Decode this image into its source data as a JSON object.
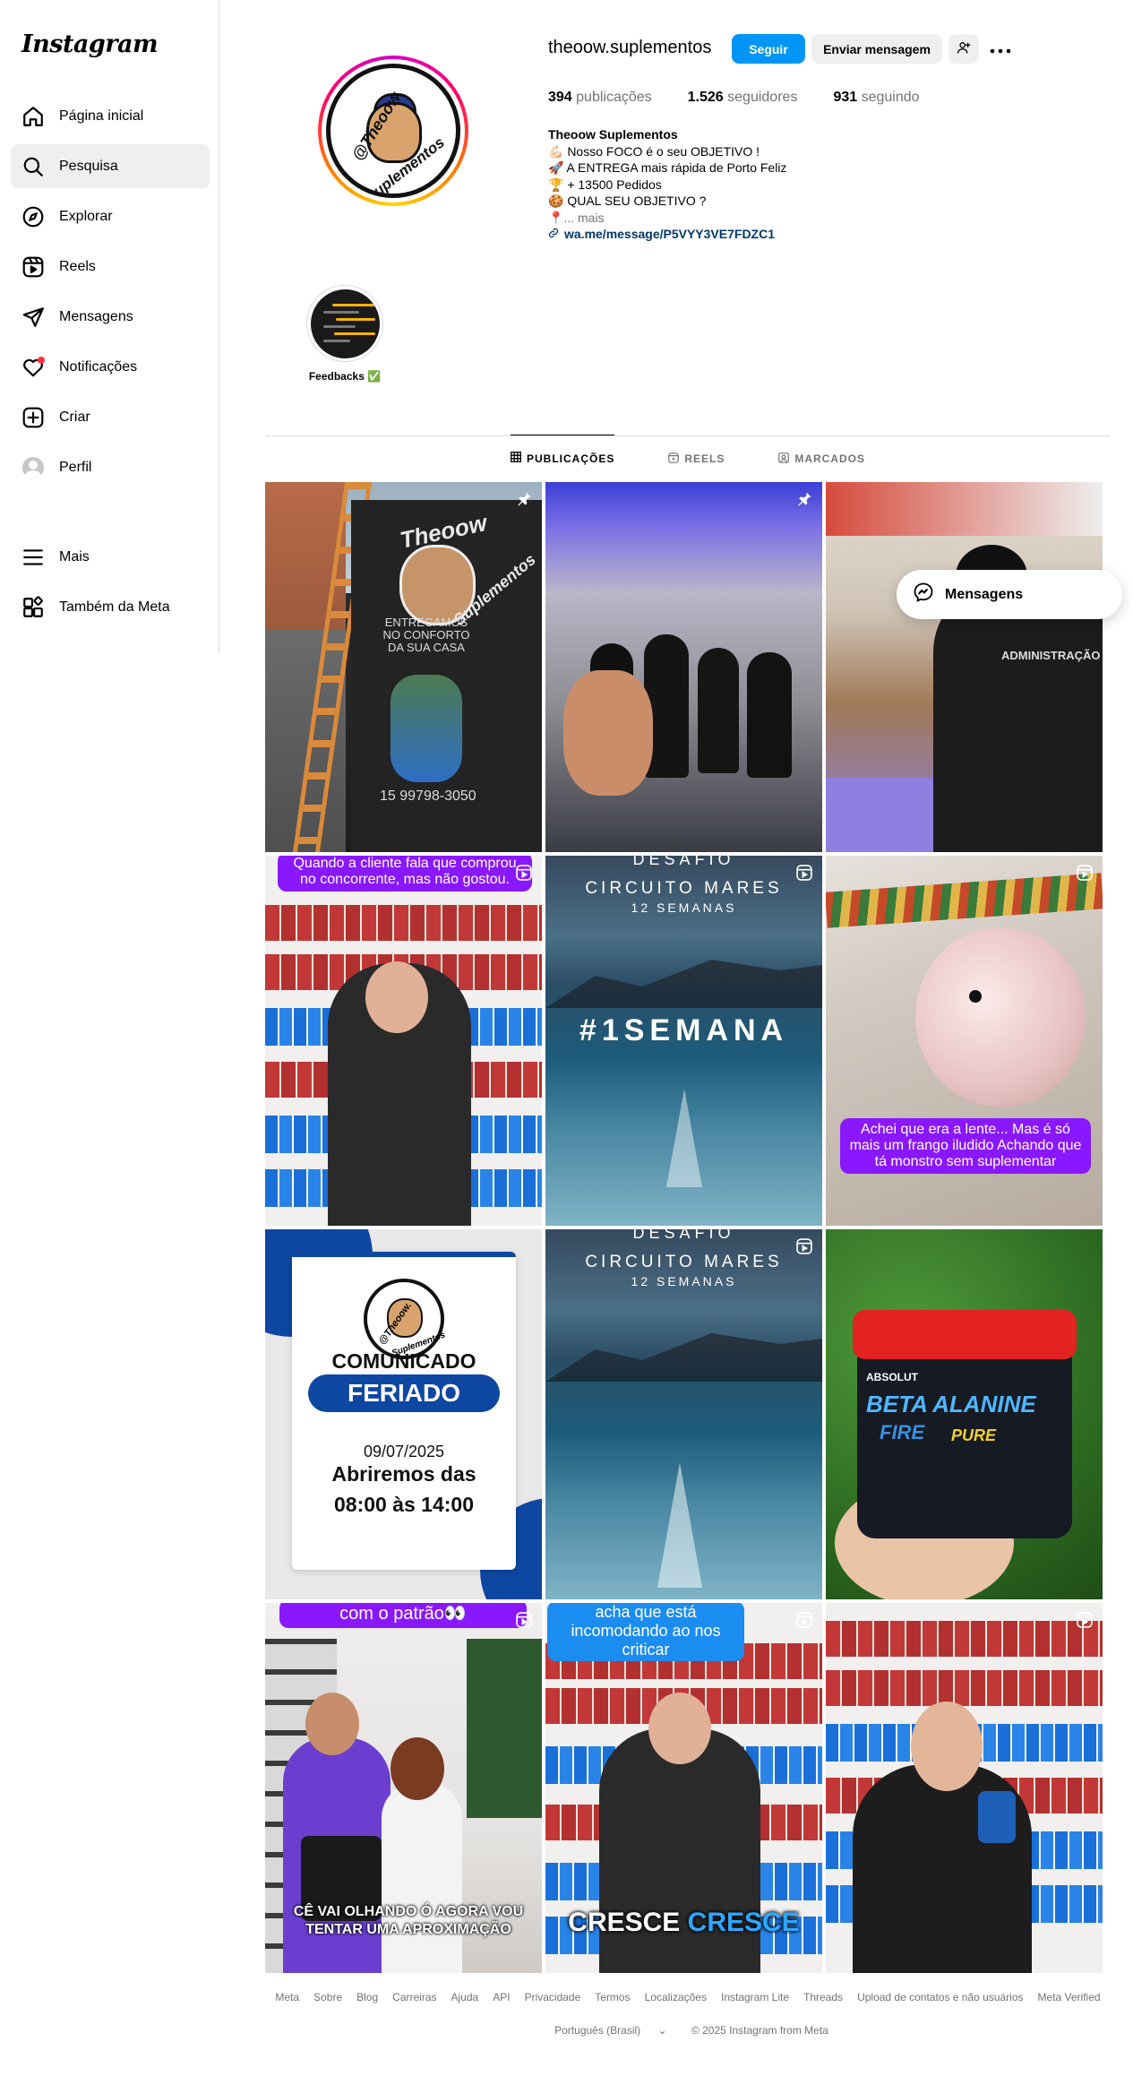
{
  "app": {
    "logo": "Instagram"
  },
  "sidebar": {
    "items": [
      {
        "label": "Página inicial",
        "icon": "home-icon"
      },
      {
        "label": "Pesquisa",
        "icon": "search-icon"
      },
      {
        "label": "Explorar",
        "icon": "compass-icon"
      },
      {
        "label": "Reels",
        "icon": "reels-icon"
      },
      {
        "label": "Mensagens",
        "icon": "send-icon"
      },
      {
        "label": "Notificações",
        "icon": "heart-icon"
      },
      {
        "label": "Criar",
        "icon": "plus-square-icon"
      },
      {
        "label": "Perfil",
        "icon": "avatar"
      }
    ],
    "bottom": [
      {
        "label": "Mais",
        "icon": "menu-icon"
      },
      {
        "label": "Também da Meta",
        "icon": "meta-apps-icon"
      }
    ],
    "active_index": 1
  },
  "profile": {
    "username": "theoow.suplementos",
    "follow_label": "Seguir",
    "message_label": "Enviar mensagem",
    "avatar_text_top": "@Theoow.",
    "avatar_text_bottom": "Suplementos",
    "stats": {
      "posts_count": "394",
      "posts_label": "publicações",
      "followers_count": "1.526",
      "followers_label": "seguidores",
      "following_count": "931",
      "following_label": "seguindo"
    },
    "bio": {
      "name": "Theoow Suplementos",
      "lines": [
        "💪🏻 Nosso FOCO é o seu OBJETIVO !",
        "🚀 A ENTREGA mais rápida de Porto Feliz",
        "🏆 + 13500 Pedidos",
        "🍪 QUAL SEU OBJETIVO ?",
        "📍... mais"
      ],
      "link": "wa.me/message/P5VYY3VE7FDZC1"
    }
  },
  "highlights": [
    {
      "label": "Feedbacks ✅"
    }
  ],
  "tabs": [
    {
      "label": "PUBLICAÇÕES",
      "icon": "grid-icon",
      "active": true
    },
    {
      "label": "REELS",
      "icon": "reels-small-icon",
      "active": false
    },
    {
      "label": "MARCADOS",
      "icon": "tagged-icon",
      "active": false
    }
  ],
  "posts": {
    "p1": {
      "text_brand_top": "Theoow",
      "text_brand_bottom": "Suplementos",
      "text_delivery": "ENTREGAMOS NO CONFORTO DA SUA CASA",
      "text_phone": "15 99798-3050",
      "badge": "pin-icon"
    },
    "p2": {
      "badge": "pin-icon"
    },
    "p3": {
      "text_shirt": "ADMINISTRAÇÃO"
    },
    "p4": {
      "caption": "Quando a cliente fala que comprou no concorrente, mas não gostou.",
      "badge": "reel-icon"
    },
    "p5": {
      "title1": "DESAFIO",
      "title2": "CIRCUITO MARES",
      "title3": "12 SEMANAS",
      "center": "#1SEMANA",
      "badge": "reel-icon"
    },
    "p6": {
      "caption": "Achei que era a lente... Mas é só mais um frango iludido Achando que tá monstro sem suplementar",
      "badge": "reel-icon"
    },
    "p7": {
      "logo_top": "@Theoow.",
      "logo_bottom": "Suplementos",
      "title": "COMUNICADO",
      "subtitle": "FERIADO",
      "date": "09/07/2025",
      "line1": "Abriremos das",
      "line2": "08:00 às 14:00"
    },
    "p8": {
      "title1": "DESAFIO",
      "title2": "CIRCUITO MARES",
      "title3": "12 SEMANAS",
      "badge": "reel-icon"
    },
    "p9": {
      "brand": "ABSOLUT",
      "product1": "BETA ALANINE",
      "product2a": "FIRE",
      "product2b": "PURE"
    },
    "p10": {
      "caption": "com o patrão👀",
      "subtitle1": "CÊ VAI OLHANDO Ó AGORA VOU",
      "subtitle2": "TENTAR UMA APROXIMAÇÃO",
      "badge": "reel-icon"
    },
    "p11": {
      "caption": "acha que está incomodando ao nos criticar",
      "bottom1": "CRESCE",
      "bottom2": "CRESCE",
      "badge": "reel-icon"
    },
    "p12": {
      "badge": "reel-icon"
    }
  },
  "floating": {
    "messages_label": "Mensagens"
  },
  "footer": {
    "links": [
      "Meta",
      "Sobre",
      "Blog",
      "Carreiras",
      "Ajuda",
      "API",
      "Privacidade",
      "Termos",
      "Localizações",
      "Instagram Lite",
      "Threads",
      "Upload de contatos e não usuários",
      "Meta Verified"
    ],
    "language": "Português (Brasil)",
    "copyright": "© 2025 Instagram from Meta"
  },
  "colors": {
    "accent": "#0095f6",
    "caption_purple": "#8a18ff",
    "caption_blue": "#1b8cf0",
    "link": "#00376b"
  }
}
